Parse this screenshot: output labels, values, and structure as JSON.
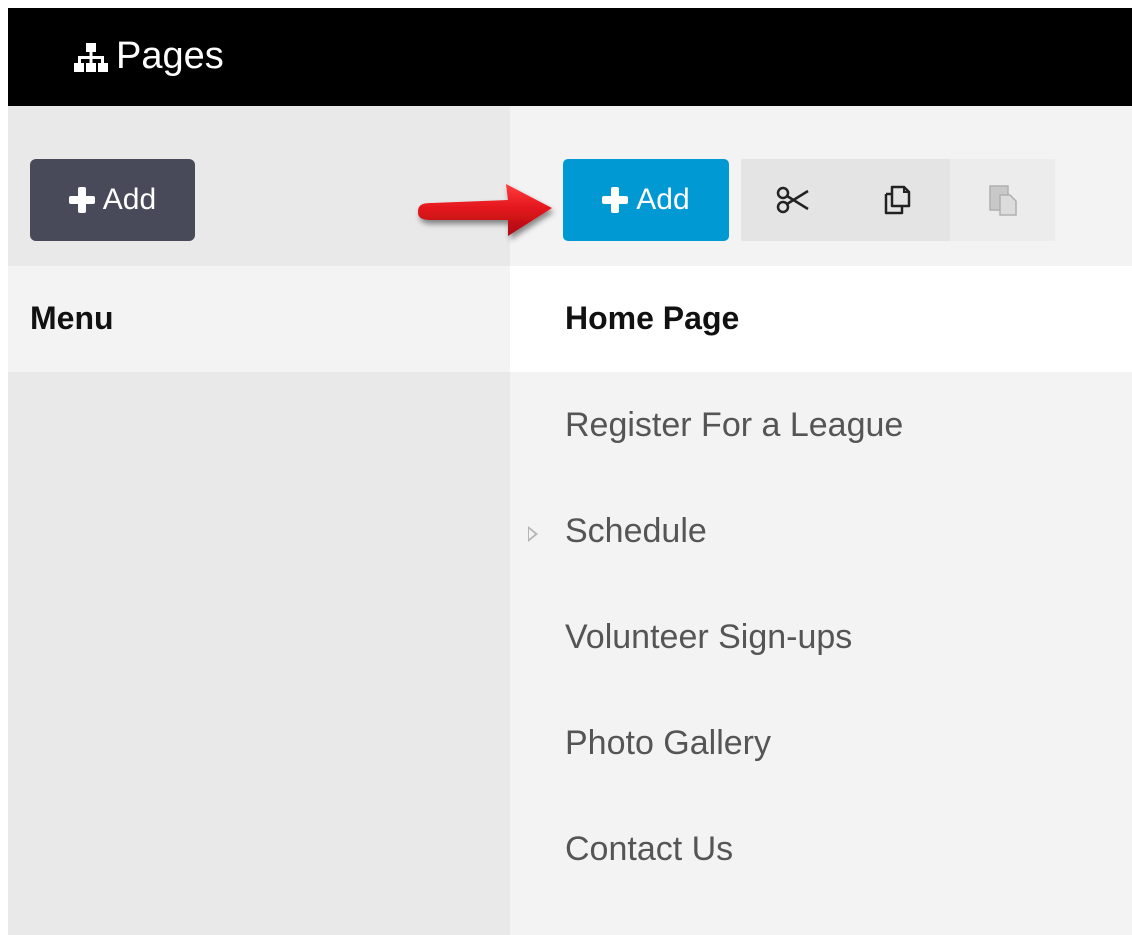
{
  "header": {
    "title": "Pages",
    "icon": "sitemap-icon"
  },
  "left_panel": {
    "add_button_label": "Add",
    "column_header": "Menu"
  },
  "right_panel": {
    "add_button_label": "Add",
    "tools": [
      {
        "icon": "cut-icon",
        "enabled": true
      },
      {
        "icon": "copy-icon",
        "enabled": true
      },
      {
        "icon": "paste-icon",
        "enabled": false
      }
    ],
    "column_header": "Home Page",
    "pages": [
      {
        "label": "Register For a League",
        "has_children": false
      },
      {
        "label": "Schedule",
        "has_children": true
      },
      {
        "label": "Volunteer Sign-ups",
        "has_children": false
      },
      {
        "label": "Photo Gallery",
        "has_children": false
      },
      {
        "label": "Contact Us",
        "has_children": false
      }
    ]
  },
  "colors": {
    "header_bg": "#000000",
    "dark_button": "#484a5a",
    "accent_button": "#0099d4",
    "annotation_arrow": "#e0141b"
  }
}
